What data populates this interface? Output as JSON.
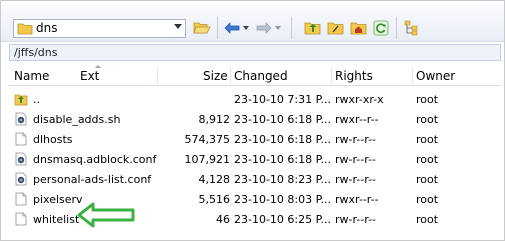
{
  "toolbar": {
    "location": "dns",
    "icons": [
      "folder-icon",
      "open-folder-icon",
      "back-arrow-icon",
      "forward-arrow-icon",
      "parent-folder-icon",
      "root-folder-icon",
      "home-folder-icon",
      "refresh-icon",
      "tree-icon"
    ]
  },
  "path": "/jffs/dns",
  "columns": {
    "name": "Name",
    "ext": "Ext",
    "size": "Size",
    "changed": "Changed",
    "rights": "Rights",
    "owner": "Owner"
  },
  "files": [
    {
      "name": "..",
      "size": "",
      "changed": "23-10-10 7:31 P...",
      "rights": "rwxr-xr-x",
      "owner": "root",
      "icon": "parent-dir-icon"
    },
    {
      "name": "disable_adds.sh",
      "size": "8,912",
      "changed": "23-10-10 6:18 P...",
      "rights": "rwxr--r--",
      "owner": "root",
      "icon": "script-file-icon"
    },
    {
      "name": "dlhosts",
      "size": "574,375",
      "changed": "23-10-10 6:18 P...",
      "rights": "rw-r--r--",
      "owner": "root",
      "icon": "file-icon"
    },
    {
      "name": "dnsmasq.adblock.conf",
      "size": "107,921",
      "changed": "23-10-10 6:18 P...",
      "rights": "rw-r--r--",
      "owner": "root",
      "icon": "config-file-icon"
    },
    {
      "name": "personal-ads-list.conf",
      "size": "4,128",
      "changed": "23-10-10 8:23 P...",
      "rights": "rw-r--r--",
      "owner": "root",
      "icon": "config-file-icon"
    },
    {
      "name": "pixelserv",
      "size": "5,516",
      "changed": "23-10-10 8:03 P...",
      "rights": "rwxr--r--",
      "owner": "root",
      "icon": "file-icon"
    },
    {
      "name": "whitelist",
      "size": "46",
      "changed": "23-10-10 6:25 P...",
      "rights": "rw-r--r--",
      "owner": "root",
      "icon": "file-icon"
    }
  ],
  "colors": {
    "annotation_arrow": "#3cb043",
    "path_bg": "#eef3fb"
  }
}
